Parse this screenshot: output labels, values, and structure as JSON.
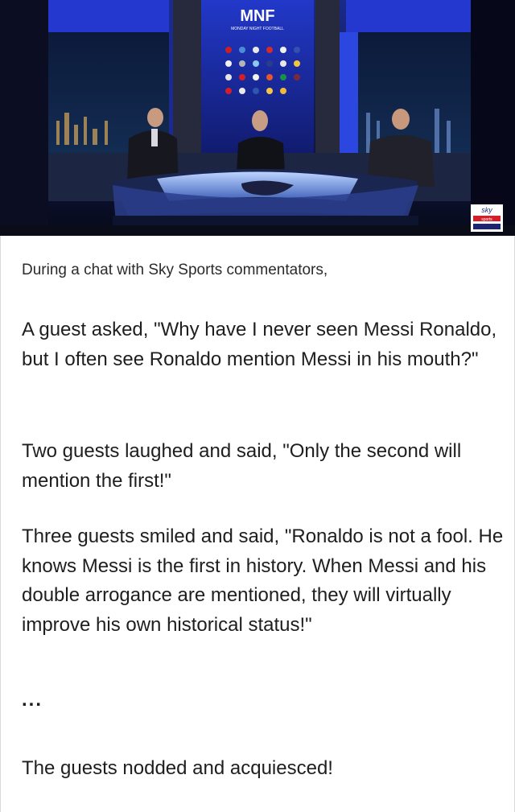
{
  "hero_image": {
    "show_logo": "MNF",
    "show_subtitle": "MONDAY NIGHT FOOTBALL",
    "broadcaster_badge": "sky",
    "broadcaster_badge_sub": "sports",
    "colors": {
      "studio_blue": "#2a3fd6",
      "desk_blue": "#7ea7f0",
      "panel_dark": "#101428"
    }
  },
  "article": {
    "intro": "During a chat with Sky Sports commentators,",
    "paragraphs": [
      "A guest asked, \"Why have I never seen Messi Ronaldo, but I often see Ronaldo mention Messi in his mouth?\"",
      "Two guests laughed and said, \"Only the second will mention the first!\"",
      "Three guests smiled and said, \"Ronaldo is not a fool. He knows Messi is the first in history. When Messi and his double arrogance are mentioned, they will virtually improve his own historical status!\"",
      "...",
      "The guests nodded and acquiesced!"
    ]
  }
}
